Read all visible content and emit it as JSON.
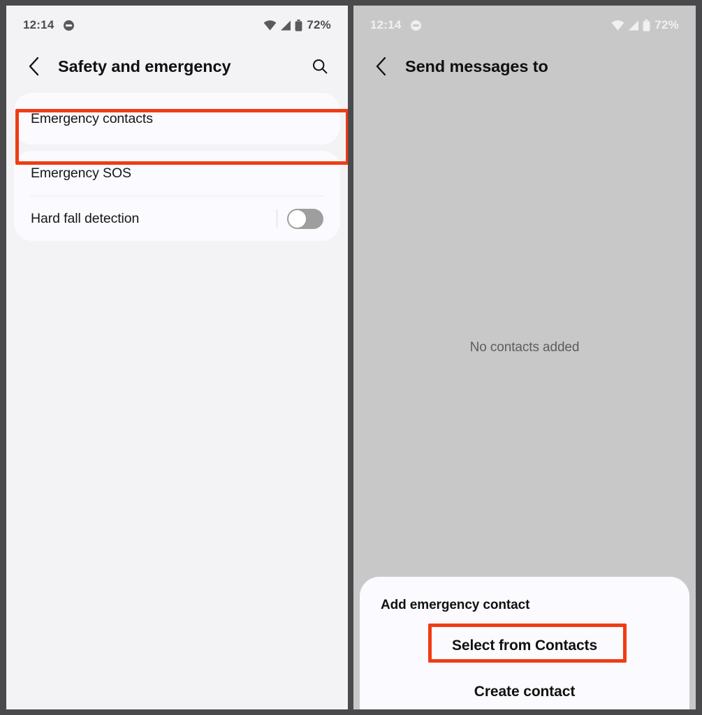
{
  "status_bar": {
    "time": "12:14",
    "dnd_icon": "do-not-disturb-icon",
    "wifi_icon": "wifi-icon",
    "signal_icon": "cellular-signal-icon",
    "battery_icon": "battery-icon",
    "battery_percent": "72%"
  },
  "left_screen": {
    "back_icon": "back-chevron-icon",
    "title": "Safety and emergency",
    "search_icon": "search-icon",
    "cards": [
      {
        "rows": [
          {
            "label": "Emergency contacts",
            "type": "link",
            "highlighted": true
          }
        ]
      },
      {
        "rows": [
          {
            "label": "Emergency SOS",
            "type": "link",
            "highlighted": false
          },
          {
            "label": "Hard fall detection",
            "type": "toggle",
            "toggle_state": "off",
            "highlighted": false
          }
        ]
      }
    ]
  },
  "right_screen": {
    "back_icon": "back-chevron-icon",
    "title": "Send messages to",
    "empty_state_text": "No contacts added",
    "bottom_sheet": {
      "title": "Add emergency contact",
      "items": [
        {
          "label": "Select from Contacts",
          "highlighted": true
        },
        {
          "label": "Create contact",
          "highlighted": false
        }
      ]
    }
  },
  "annotations": {
    "highlight_color": "#f03c14",
    "boxes": [
      {
        "target": "Emergency contacts"
      },
      {
        "target": "Select from Contacts"
      }
    ]
  }
}
